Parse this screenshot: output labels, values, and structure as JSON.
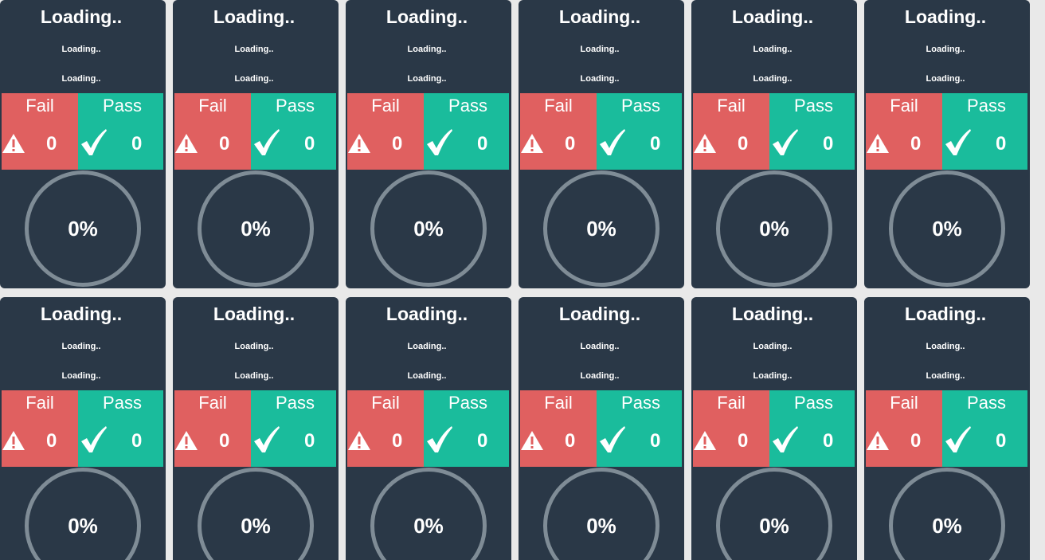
{
  "cards": [
    {
      "title": "Loading..",
      "subtitle": "Loading..",
      "detail": "Loading..",
      "fail_label": "Fail",
      "fail_count": "0",
      "pass_label": "Pass",
      "pass_count": "0",
      "progress": "0%"
    },
    {
      "title": "Loading..",
      "subtitle": "Loading..",
      "detail": "Loading..",
      "fail_label": "Fail",
      "fail_count": "0",
      "pass_label": "Pass",
      "pass_count": "0",
      "progress": "0%"
    },
    {
      "title": "Loading..",
      "subtitle": "Loading..",
      "detail": "Loading..",
      "fail_label": "Fail",
      "fail_count": "0",
      "pass_label": "Pass",
      "pass_count": "0",
      "progress": "0%"
    },
    {
      "title": "Loading..",
      "subtitle": "Loading..",
      "detail": "Loading..",
      "fail_label": "Fail",
      "fail_count": "0",
      "pass_label": "Pass",
      "pass_count": "0",
      "progress": "0%"
    },
    {
      "title": "Loading..",
      "subtitle": "Loading..",
      "detail": "Loading..",
      "fail_label": "Fail",
      "fail_count": "0",
      "pass_label": "Pass",
      "pass_count": "0",
      "progress": "0%"
    },
    {
      "title": "Loading..",
      "subtitle": "Loading..",
      "detail": "Loading..",
      "fail_label": "Fail",
      "fail_count": "0",
      "pass_label": "Pass",
      "pass_count": "0",
      "progress": "0%"
    },
    {
      "title": "Loading..",
      "subtitle": "Loading..",
      "detail": "Loading..",
      "fail_label": "Fail",
      "fail_count": "0",
      "pass_label": "Pass",
      "pass_count": "0",
      "progress": "0%"
    },
    {
      "title": "Loading..",
      "subtitle": "Loading..",
      "detail": "Loading..",
      "fail_label": "Fail",
      "fail_count": "0",
      "pass_label": "Pass",
      "pass_count": "0",
      "progress": "0%"
    },
    {
      "title": "Loading..",
      "subtitle": "Loading..",
      "detail": "Loading..",
      "fail_label": "Fail",
      "fail_count": "0",
      "pass_label": "Pass",
      "pass_count": "0",
      "progress": "0%"
    },
    {
      "title": "Loading..",
      "subtitle": "Loading..",
      "detail": "Loading..",
      "fail_label": "Fail",
      "fail_count": "0",
      "pass_label": "Pass",
      "pass_count": "0",
      "progress": "0%"
    },
    {
      "title": "Loading..",
      "subtitle": "Loading..",
      "detail": "Loading..",
      "fail_label": "Fail",
      "fail_count": "0",
      "pass_label": "Pass",
      "pass_count": "0",
      "progress": "0%"
    },
    {
      "title": "Loading..",
      "subtitle": "Loading..",
      "detail": "Loading..",
      "fail_label": "Fail",
      "fail_count": "0",
      "pass_label": "Pass",
      "pass_count": "0",
      "progress": "0%"
    }
  ],
  "colors": {
    "card_background": "#2a3847",
    "fail": "#e06060",
    "pass": "#1abc9c",
    "ring": "#7f8c96",
    "page_background": "#e9e9e9"
  },
  "icons": {
    "fail": "warning-icon",
    "pass": "check-icon"
  }
}
